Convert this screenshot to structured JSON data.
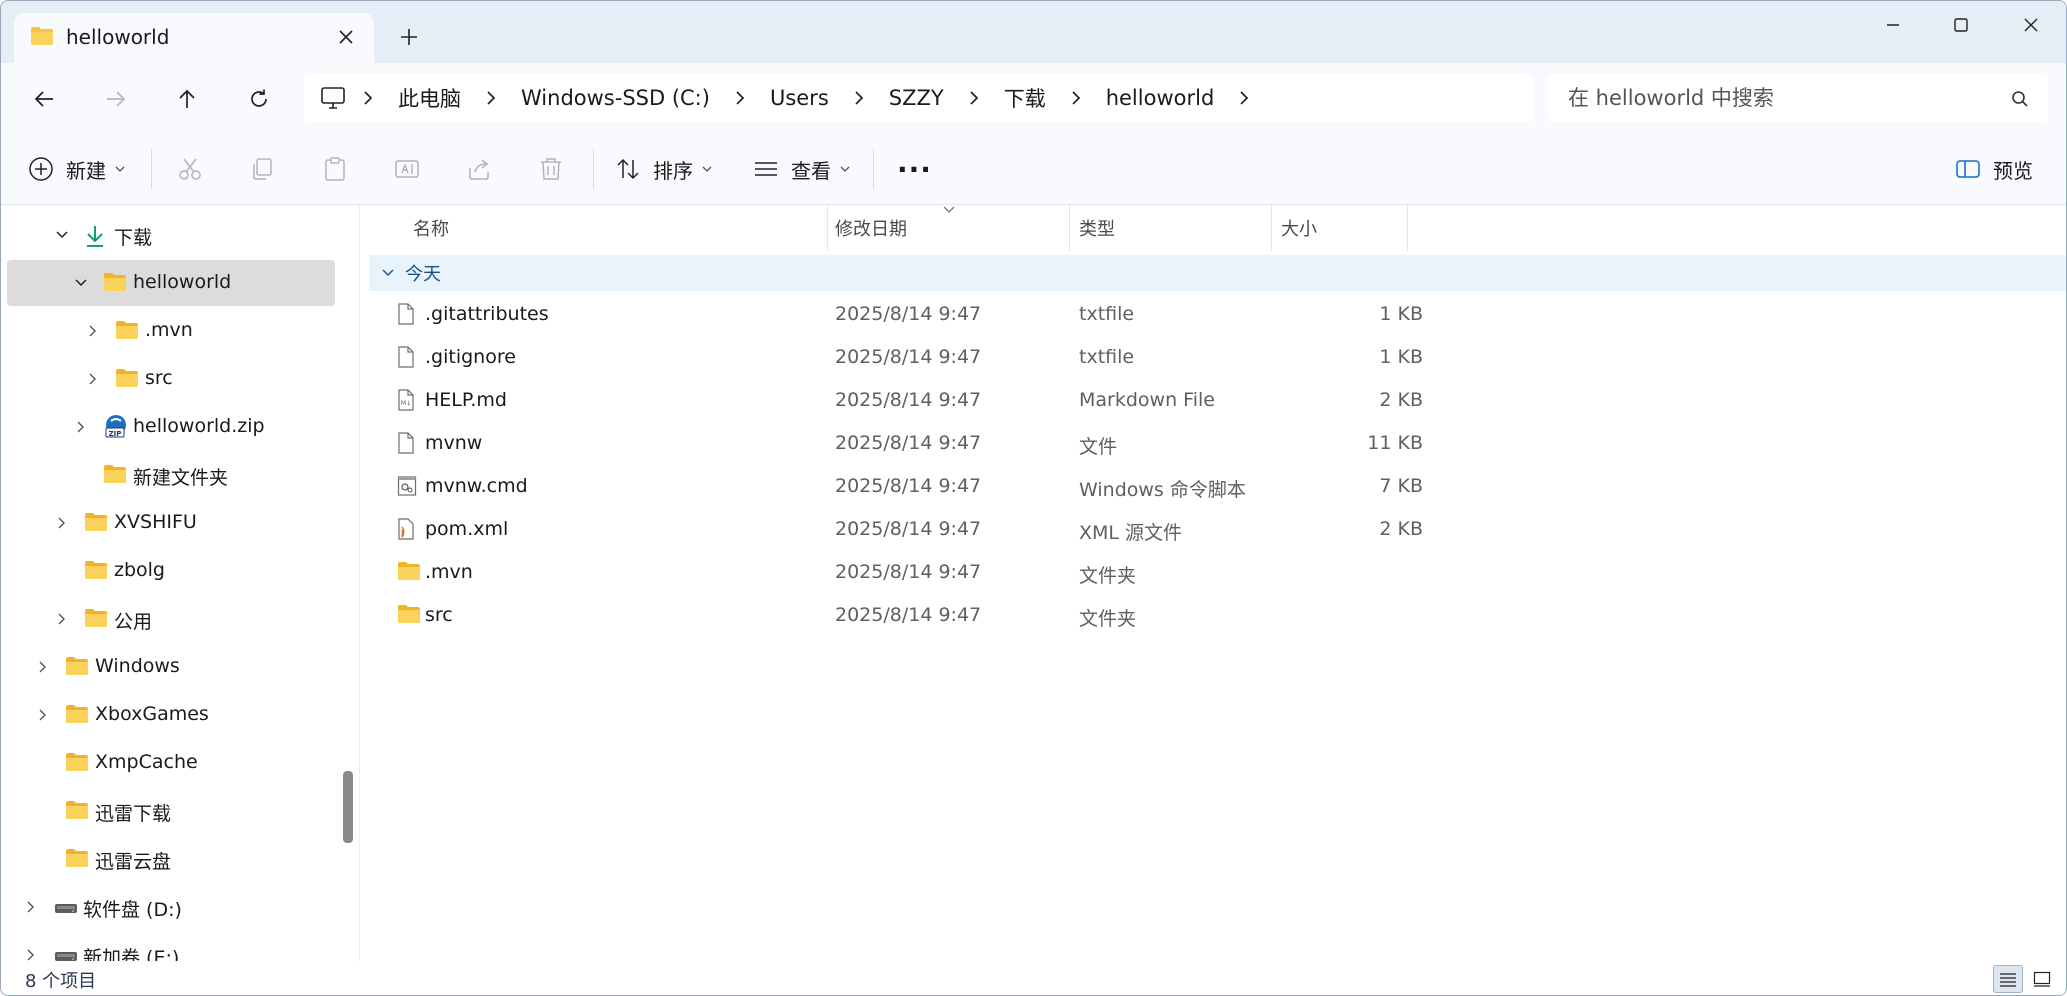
{
  "tab": {
    "title": "helloworld",
    "close_symbol": "✕",
    "new_tab_symbol": "+"
  },
  "address": {
    "crumbs": [
      "此电脑",
      "Windows-SSD (C:)",
      "Users",
      "SZZY",
      "下载",
      "helloworld"
    ]
  },
  "search": {
    "placeholder": "在 helloworld 中搜索"
  },
  "toolbar": {
    "new_label": "新建",
    "sort_label": "排序",
    "view_label": "查看",
    "more_label": "···",
    "preview_label": "预览"
  },
  "sidebar": {
    "items": [
      {
        "label": "下载",
        "indent": 3,
        "expanded": true,
        "icon": "download-icon"
      },
      {
        "label": "helloworld",
        "indent": 4,
        "expanded": true,
        "selected": true,
        "icon": "folder-icon"
      },
      {
        "label": ".mvn",
        "indent": 5,
        "expanded": false,
        "icon": "folder-icon"
      },
      {
        "label": "src",
        "indent": 5,
        "expanded": false,
        "icon": "folder-icon"
      },
      {
        "label": "helloworld.zip",
        "indent": 4,
        "expanded": false,
        "icon": "zip-icon"
      },
      {
        "label": "新建文件夹",
        "indent": 4,
        "expanded": null,
        "icon": "folder-icon"
      },
      {
        "label": "XVSHIFU",
        "indent": 3,
        "expanded": false,
        "icon": "folder-icon"
      },
      {
        "label": "zbolg",
        "indent": 3,
        "expanded": null,
        "icon": "folder-icon"
      },
      {
        "label": "公用",
        "indent": 3,
        "expanded": false,
        "icon": "folder-icon"
      },
      {
        "label": "Windows",
        "indent": 2,
        "expanded": false,
        "icon": "folder-icon"
      },
      {
        "label": "XboxGames",
        "indent": 2,
        "expanded": false,
        "icon": "folder-icon"
      },
      {
        "label": "XmpCache",
        "indent": 2,
        "expanded": null,
        "icon": "folder-icon"
      },
      {
        "label": "迅雷下载",
        "indent": 2,
        "expanded": null,
        "icon": "folder-icon"
      },
      {
        "label": "迅雷云盘",
        "indent": 2,
        "expanded": null,
        "icon": "folder-icon"
      },
      {
        "label": "软件盘 (D:)",
        "indent": 1,
        "expanded": false,
        "icon": "drive-icon"
      },
      {
        "label": "新加卷 (E:)",
        "indent": 1,
        "expanded": false,
        "icon": "drive-icon"
      }
    ]
  },
  "columns": {
    "name": "名称",
    "date": "修改日期",
    "type": "类型",
    "size": "大小"
  },
  "group": {
    "label": "今天"
  },
  "files": [
    {
      "name": ".gitattributes",
      "date": "2025/8/14 9:47",
      "type": "txtfile",
      "size": "1 KB",
      "icon": "text-file-icon"
    },
    {
      "name": ".gitignore",
      "date": "2025/8/14 9:47",
      "type": "txtfile",
      "size": "1 KB",
      "icon": "text-file-icon"
    },
    {
      "name": "HELP.md",
      "date": "2025/8/14 9:47",
      "type": "Markdown File",
      "size": "2 KB",
      "icon": "markdown-file-icon"
    },
    {
      "name": "mvnw",
      "date": "2025/8/14 9:47",
      "type": "文件",
      "size": "11 KB",
      "icon": "text-file-icon"
    },
    {
      "name": "mvnw.cmd",
      "date": "2025/8/14 9:47",
      "type": "Windows 命令脚本",
      "size": "7 KB",
      "icon": "cmd-file-icon"
    },
    {
      "name": "pom.xml",
      "date": "2025/8/14 9:47",
      "type": "XML 源文件",
      "size": "2 KB",
      "icon": "xml-file-icon"
    },
    {
      "name": ".mvn",
      "date": "2025/8/14 9:47",
      "type": "文件夹",
      "size": "",
      "icon": "folder-icon"
    },
    {
      "name": "src",
      "date": "2025/8/14 9:47",
      "type": "文件夹",
      "size": "",
      "icon": "folder-icon"
    }
  ],
  "status": {
    "item_count": "8 个项目"
  },
  "colors": {
    "folder": "#f5c242",
    "accent": "#1b6ec2",
    "selected_bg": "#dcdcdc",
    "group_bg": "#e8f3fc"
  }
}
